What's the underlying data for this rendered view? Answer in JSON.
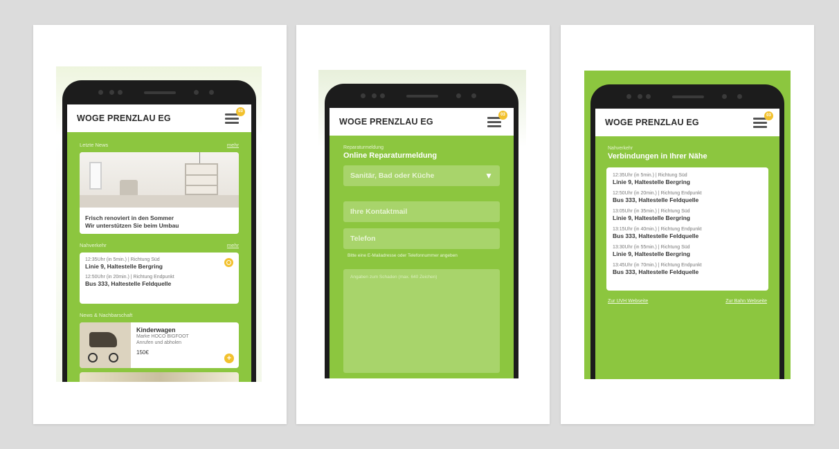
{
  "app": {
    "title": "WOGE PRENZLAU EG",
    "badge": "03"
  },
  "screen1": {
    "news_label": "Letzte News",
    "news_more": "mehr",
    "news_caption_1": "Frisch renoviert in den Sommer",
    "news_caption_2": "Wir unterstützen Sie beim Umbau",
    "transit_label": "Nahverkehr",
    "transit_more": "mehr",
    "connections": [
      {
        "meta": "12:35Uhr (in 5min.)  |  Richtung Süd",
        "line": "Linie 9, Haltestelle Bergring"
      },
      {
        "meta": "12:50Uhr (in 20min.)  |  Richtung Endpunkt",
        "line": "Bus 333, Haltestelle Feldquelle"
      }
    ],
    "neighbors_label": "News & Nachbarschaft",
    "listing": {
      "title": "Kinderwagen",
      "line1": "Marke HOCO BIGFOOT",
      "line2": "Anrufen und abholen",
      "price": "150€",
      "plus": "+"
    }
  },
  "screen2": {
    "small_label": "Reparaturmeldung",
    "title": "Online Reparaturmeldung",
    "select_value": "Sanitär, Bad oder Küche",
    "select_caret": "▼",
    "email_placeholder": "Ihre Kontaktmail",
    "phone_placeholder": "Telefon",
    "hint": "Bitte eine E-Mailadresse oder Telefonnummer angeben",
    "textarea_placeholder": "Angaben zum Schaden (max. 640 Zeichen)"
  },
  "screen3": {
    "small_label": "Nahverkehr",
    "title": "Verbindungen in Ihrer Nähe",
    "connections": [
      {
        "meta": "12:35Uhr (in 5min.)  |  Richtung Süd",
        "line": "Linie 9, Haltestelle Bergring"
      },
      {
        "meta": "12:50Uhr (in 20min.)  |  Richtung Endpunkt",
        "line": "Bus 333, Haltestelle Feldquelle"
      },
      {
        "meta": "13:05Uhr (in 35min.)  |  Richtung Süd",
        "line": "Linie 9, Haltestelle Bergring"
      },
      {
        "meta": "13:15Uhr (in 40min.)  |  Richtung Endpunkt",
        "line": "Bus 333, Haltestelle Feldquelle"
      },
      {
        "meta": "13:30Uhr (in 55min.)  |  Richtung Süd",
        "line": "Linie 9, Haltestelle Bergring"
      },
      {
        "meta": "13:45Uhr (in 70min.)  |  Richtung Endpunkt",
        "line": "Bus 333, Haltestelle Feldquelle"
      }
    ],
    "link_left": "Zur UVH Webseite",
    "link_right": "Zur Bahn Webseite"
  },
  "colors": {
    "brand_green": "#8cc63f",
    "accent_yellow": "#f2c12e",
    "field_green": "#a8d46b"
  }
}
